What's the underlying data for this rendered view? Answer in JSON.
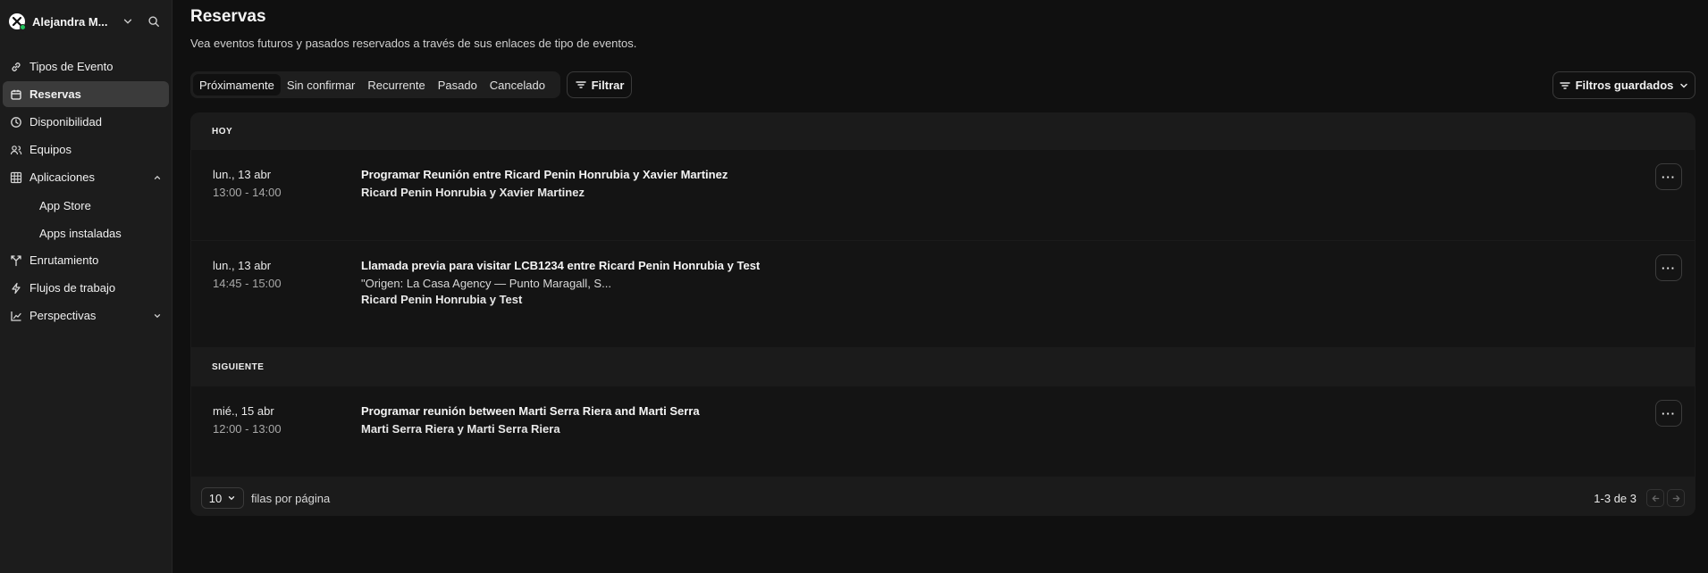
{
  "user": {
    "name": "Alejandra M..."
  },
  "nav": {
    "items": [
      {
        "label": "Tipos de Evento"
      },
      {
        "label": "Reservas"
      },
      {
        "label": "Disponibilidad"
      },
      {
        "label": "Equipos"
      },
      {
        "label": "Aplicaciones"
      },
      {
        "label": "App Store"
      },
      {
        "label": "Apps instaladas"
      },
      {
        "label": "Enrutamiento"
      },
      {
        "label": "Flujos de trabajo"
      },
      {
        "label": "Perspectivas"
      }
    ]
  },
  "page": {
    "title": "Reservas",
    "subtitle": "Vea eventos futuros y pasados reservados a través de sus enlaces de tipo de eventos."
  },
  "tabs": [
    "Próximamente",
    "Sin confirmar",
    "Recurrente",
    "Pasado",
    "Cancelado"
  ],
  "toolbar": {
    "filter_label": "Filtrar",
    "saved_filters_label": "Filtros guardados"
  },
  "sections": [
    {
      "heading": "HOY",
      "bookings": [
        {
          "date": "lun., 13 abr",
          "time": "13:00 - 14:00",
          "title": "Programar Reunión entre Ricard Penin Honrubia y Xavier Martinez",
          "attendees": "Ricard Penin Honrubia y Xavier Martinez"
        },
        {
          "date": "lun., 13 abr",
          "time": "14:45 - 15:00",
          "title": "Llamada previa para visitar LCB1234 entre Ricard Penin Honrubia y Test",
          "description": "\"Origen: La Casa Agency — Punto Maragall, S...",
          "attendees": "Ricard Penin Honrubia y Test"
        }
      ]
    },
    {
      "heading": "SIGUIENTE",
      "bookings": [
        {
          "date": "mié., 15 abr",
          "time": "12:00 - 13:00",
          "title": "Programar reunión between Marti Serra Riera and Marti Serra",
          "attendees": "Marti Serra Riera y Marti Serra Riera"
        }
      ]
    }
  ],
  "footer": {
    "rows_value": "10",
    "rows_label": "filas por página",
    "range": "1-3 de 3"
  },
  "colors": {
    "background": "#101010",
    "sidebar": "#1c1c1c",
    "active_nav": "#3b3b3b",
    "status_online": "#22c55e"
  }
}
